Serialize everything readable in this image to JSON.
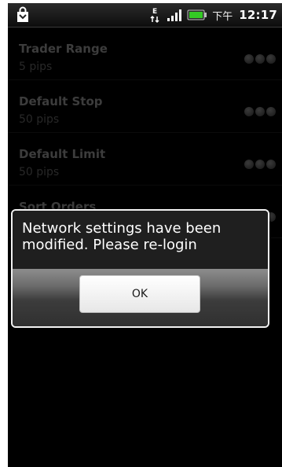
{
  "statusbar": {
    "ampm": "下午",
    "time": "12:17",
    "icons": [
      "shopping-bag-icon",
      "data-transfer-icon",
      "signal-icon",
      "battery-icon"
    ],
    "data_indicator": "E",
    "battery_color": "#34c924"
  },
  "settings": {
    "items": [
      {
        "title": "Trader Range",
        "value": "5 pips"
      },
      {
        "title": "Default Stop",
        "value": "50 pips"
      },
      {
        "title": "Default Limit",
        "value": "50 pips"
      },
      {
        "title": "Sort Orders",
        "value": ""
      }
    ]
  },
  "dialog": {
    "message": "Network settings have been modified. Please re-login",
    "ok_label": "OK"
  }
}
